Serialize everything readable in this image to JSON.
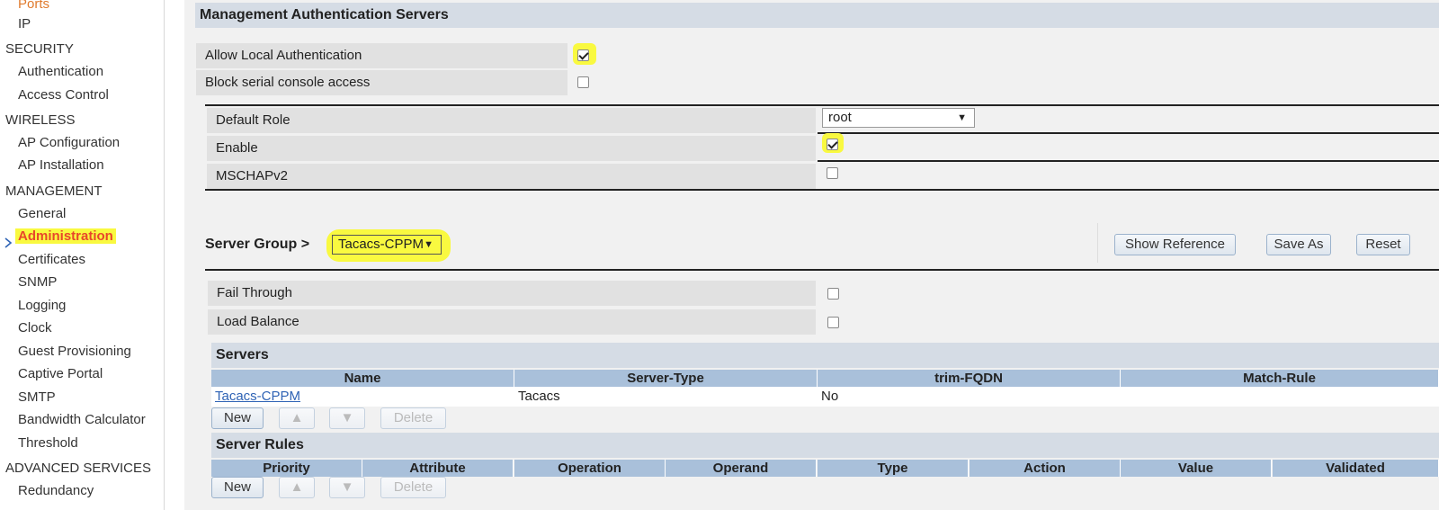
{
  "sidebar": {
    "items": [
      {
        "label": "Ports",
        "kind": "item orange"
      },
      {
        "label": "IP",
        "kind": "item"
      },
      {
        "label": "SECURITY",
        "kind": "section"
      },
      {
        "label": "Authentication",
        "kind": "item"
      },
      {
        "label": "Access Control",
        "kind": "item"
      },
      {
        "label": "WIRELESS",
        "kind": "section"
      },
      {
        "label": "AP Configuration",
        "kind": "item"
      },
      {
        "label": "AP Installation",
        "kind": "item"
      },
      {
        "label": "MANAGEMENT",
        "kind": "section"
      },
      {
        "label": "General",
        "kind": "item"
      },
      {
        "label": "Administration",
        "kind": "item active"
      },
      {
        "label": "Certificates",
        "kind": "item"
      },
      {
        "label": "SNMP",
        "kind": "item"
      },
      {
        "label": "Logging",
        "kind": "item"
      },
      {
        "label": "Clock",
        "kind": "item"
      },
      {
        "label": "Guest Provisioning",
        "kind": "item"
      },
      {
        "label": "Captive Portal",
        "kind": "item"
      },
      {
        "label": "SMTP",
        "kind": "item"
      },
      {
        "label": "Bandwidth Calculator",
        "kind": "item"
      },
      {
        "label": "Threshold",
        "kind": "item"
      },
      {
        "label": "ADVANCED SERVICES",
        "kind": "section"
      },
      {
        "label": "Redundancy",
        "kind": "item"
      }
    ]
  },
  "mgmt": {
    "title": "Management Authentication Servers",
    "allow_local_label": "Allow Local Authentication",
    "allow_local_checked": true,
    "block_serial_label": "Block serial console access",
    "block_serial_checked": false,
    "default_role_label": "Default Role",
    "default_role_value": "root",
    "enable_label": "Enable",
    "enable_checked": true,
    "mschap_label": "MSCHAPv2",
    "mschap_checked": false
  },
  "server_group": {
    "label": "Server Group >",
    "selected": "Tacacs-CPPM",
    "show_reference": "Show Reference",
    "save_as": "Save As",
    "reset": "Reset",
    "fail_through_label": "Fail Through",
    "fail_through_checked": false,
    "load_balance_label": "Load Balance",
    "load_balance_checked": false
  },
  "servers": {
    "title": "Servers",
    "columns": [
      "Name",
      "Server-Type",
      "trim-FQDN",
      "Match-Rule"
    ],
    "rows": [
      {
        "name": "Tacacs-CPPM",
        "type": "Tacacs",
        "fqdn": "No",
        "match": ""
      }
    ],
    "new_label": "New",
    "up_label": "▲",
    "down_label": "▼",
    "delete_label": "Delete"
  },
  "server_rules": {
    "title": "Server Rules",
    "columns": [
      "Priority",
      "Attribute",
      "Operation",
      "Operand",
      "Type",
      "Action",
      "Value",
      "Validated"
    ],
    "new_label": "New",
    "up_label": "▲",
    "down_label": "▼",
    "delete_label": "Delete"
  },
  "colors": {
    "highlight": "#f9f940",
    "active_link": "#e8462a",
    "table_header": "#a9c0da",
    "section_header": "#d5dce5"
  }
}
